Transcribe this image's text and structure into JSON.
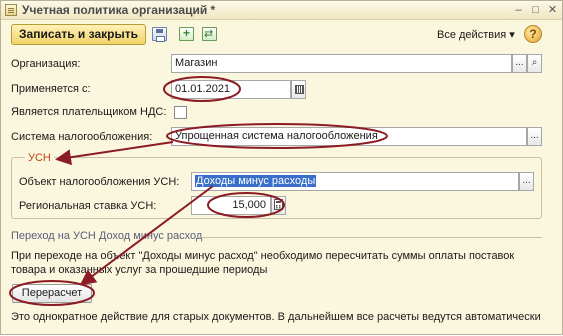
{
  "window": {
    "title": "Учетная политика организаций *",
    "controls": {
      "minimize": "–",
      "maximize": "□",
      "close": "✕"
    }
  },
  "toolbar": {
    "save_close_label": "Записать и закрыть",
    "all_actions_label": "Все действия",
    "all_actions_arrow": "▾",
    "help_label": "?",
    "icons": [
      "save-icon",
      "copy-icon",
      "refresh-icon"
    ]
  },
  "form": {
    "organization": {
      "label": "Организация:",
      "value": "Магазин"
    },
    "applies_from": {
      "label": "Применяется с:",
      "value": "01.01.2021"
    },
    "vat_payer": {
      "label": "Является плательщиком НДС:",
      "checked": false
    },
    "tax_system": {
      "label": "Система налогообложения:",
      "value": "Упрощенная система налогообложения"
    }
  },
  "usn": {
    "title": "УСН",
    "object": {
      "label": "Объект налогообложения УСН:",
      "value": "Доходы минус расходы"
    },
    "rate": {
      "label": "Региональная ставка УСН:",
      "value": "15,000"
    }
  },
  "transition": {
    "title": "Переход на УСН Доход минус расход",
    "text1": "При переходе на объект \"Доходы минус расход\" необходимо пересчитать суммы оплаты поставок",
    "text2": "товара и оказанных услуг за прошедшие периоды",
    "button_label": "Перерасчет",
    "footer": "Это однократное действие для старых документов. В дальнейшем все расчеты ведутся автоматически"
  },
  "buttons": {
    "ellipsis": "...",
    "search": "⌕"
  },
  "colors": {
    "annotation": "#8b1b24",
    "background": "#fbf6de",
    "accent": "#f1d36a"
  }
}
